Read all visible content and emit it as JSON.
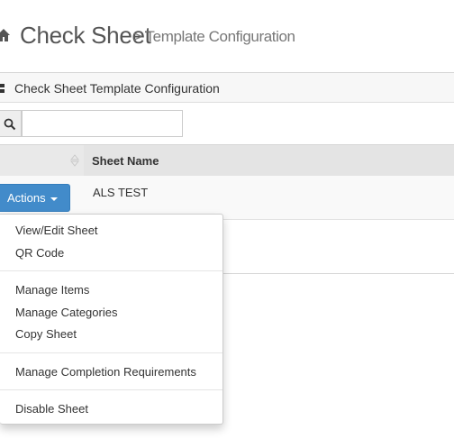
{
  "header": {
    "title": "Check Sheet",
    "subtitle": "> Template Configuration",
    "icon": "home-icon"
  },
  "panel": {
    "title": "Check Sheet Template Configuration",
    "icon": "list-icon"
  },
  "search": {
    "icon": "search-icon",
    "value": "",
    "placeholder": ""
  },
  "table": {
    "columns": [
      "",
      "Sheet Name"
    ],
    "rows": [
      {
        "action_label": "Actions",
        "sheet_name": "ALS TEST"
      }
    ]
  },
  "dropdown": {
    "groups": [
      [
        "View/Edit Sheet",
        "QR Code"
      ],
      [
        "Manage Items",
        "Manage Categories",
        "Copy Sheet"
      ],
      [
        "Manage Completion Requirements"
      ],
      [
        "Disable Sheet"
      ]
    ],
    "items": {
      "view_edit": "View/Edit Sheet",
      "qr_code": "QR Code",
      "manage_items": "Manage Items",
      "manage_categories": "Manage Categories",
      "copy_sheet": "Copy Sheet",
      "manage_completion": "Manage Completion Requirements",
      "disable_sheet": "Disable Sheet"
    }
  },
  "colors": {
    "primary_button": "#428bca",
    "header_bg": "#f7f7f7",
    "table_head_bg": "#e9e9e9"
  }
}
